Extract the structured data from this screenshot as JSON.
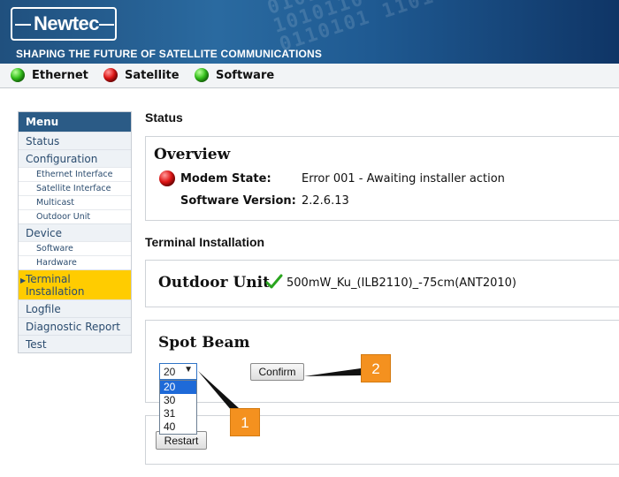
{
  "header": {
    "logo_text": "Newtec",
    "tagline": "SHAPING THE FUTURE OF SATELLITE COMMUNICATIONS",
    "binary_pattern": "0101101 0110\n1010110 1010\n0110101 1101"
  },
  "statusbar": {
    "items": [
      {
        "label": "Ethernet",
        "status": "green"
      },
      {
        "label": "Satellite",
        "status": "red"
      },
      {
        "label": "Software",
        "status": "green"
      }
    ]
  },
  "menu": {
    "title": "Menu",
    "items": [
      {
        "label": "Status"
      },
      {
        "label": "Configuration"
      },
      {
        "label": "Ethernet Interface"
      },
      {
        "label": "Satellite Interface"
      },
      {
        "label": "Multicast"
      },
      {
        "label": "Outdoor Unit"
      },
      {
        "label": "Device"
      },
      {
        "label": "Software"
      },
      {
        "label": "Hardware"
      },
      {
        "label": "Terminal Installation",
        "label_line1": "Terminal",
        "label_line2": "Installation"
      },
      {
        "label": "Logfile"
      },
      {
        "label": "Diagnostic Report"
      },
      {
        "label": "Test"
      }
    ]
  },
  "status_section": {
    "heading": "Status",
    "overview": {
      "title": "Overview",
      "modem_state_label": "Modem State:",
      "modem_state_value": "Error 001 - Awaiting installer action",
      "software_version_label": "Software Version:",
      "software_version_value": "2.2.6.13"
    }
  },
  "terminal_installation": {
    "heading": "Terminal Installation",
    "outdoor_unit": {
      "title": "Outdoor Unit",
      "value": "500mW_Ku_(ILB2110)_-75cm(ANT2010)"
    },
    "spot_beam": {
      "title": "Spot Beam",
      "selected": "20",
      "options": [
        "20",
        "30",
        "31",
        "40"
      ],
      "confirm_label": "Confirm"
    },
    "restart_label": "Restart"
  },
  "callouts": [
    {
      "number": "1"
    },
    {
      "number": "2"
    }
  ],
  "colors": {
    "accent": "#2b5b86",
    "active_menu": "#ffcc00",
    "callout": "#f4911f",
    "led_green": "#35c31c",
    "led_red": "#e01515"
  }
}
